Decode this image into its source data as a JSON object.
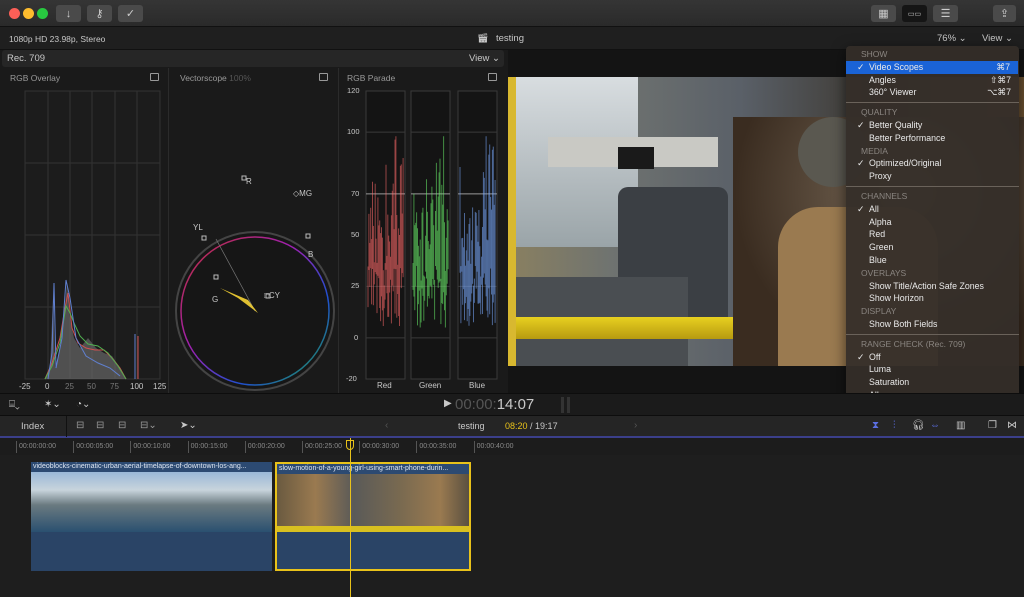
{
  "titlebar": {
    "buttons": [
      "import-icon",
      "key-icon",
      "checkmark-icon"
    ],
    "right_buttons": [
      "browser-layout-icon",
      "timeline-layout-icon",
      "inspector-icon",
      "share-icon"
    ]
  },
  "infobar": {
    "format": "1080p HD 23.98p, Stereo",
    "project": "testing",
    "zoom": "76%",
    "view": "View"
  },
  "scopes": {
    "standard": "Rec. 709",
    "view": "View",
    "rgb_overlay": {
      "title": "RGB Overlay",
      "x_ticks": [
        "-25",
        "0",
        "25",
        "50",
        "75",
        "100",
        "125"
      ]
    },
    "vectorscope": {
      "title": "Vectorscope",
      "scale": "100%",
      "targets": [
        "R",
        "MG",
        "YL",
        "B",
        "G",
        "CY"
      ]
    },
    "rgb_parade": {
      "title": "RGB Parade",
      "y_ticks": [
        "120",
        "100",
        "70",
        "50",
        "25",
        "0",
        "-20"
      ],
      "channels": [
        "Red",
        "Green",
        "Blue"
      ]
    }
  },
  "controls": {
    "timecode_dim": "00:00:",
    "timecode": "14:07"
  },
  "timeline": {
    "index": "Index",
    "project": "testing",
    "position": "08:20",
    "duration": "19:17",
    "ruler": [
      "00:00:00:00",
      "00:00:05:00",
      "00:00:10:00",
      "00:00:15:00",
      "00:00:20:00",
      "00:00:25:00",
      "00:00:30:00",
      "00:00:35:00",
      "00:00:40:00"
    ],
    "clips": [
      {
        "name": "videoblocks-cinematic-urban-aerial-timelapse-of-downtown-los-ang..."
      },
      {
        "name": "slow-motion-of-a-young-girl-using-smart-phone-durin..."
      }
    ]
  },
  "menu": {
    "show_header": "SHOW",
    "show": [
      {
        "label": "Video Scopes",
        "checked": true,
        "shortcut": "⌘7",
        "highlighted": true
      },
      {
        "label": "Angles",
        "shortcut": "⇧⌘7"
      },
      {
        "label": "360° Viewer",
        "shortcut": "⌥⌘7"
      }
    ],
    "quality_header": "QUALITY",
    "quality": [
      {
        "label": "Better Quality",
        "checked": true
      },
      {
        "label": "Better Performance"
      }
    ],
    "media_header": "MEDIA",
    "media": [
      {
        "label": "Optimized/Original",
        "checked": true
      },
      {
        "label": "Proxy"
      }
    ],
    "channels_header": "CHANNELS",
    "channels": [
      {
        "label": "All",
        "checked": true
      },
      {
        "label": "Alpha"
      },
      {
        "label": "Red"
      },
      {
        "label": "Green"
      },
      {
        "label": "Blue"
      }
    ],
    "overlays_header": "OVERLAYS",
    "overlays": [
      {
        "label": "Show Title/Action Safe Zones"
      },
      {
        "label": "Show Horizon"
      }
    ],
    "display_header": "DISPLAY",
    "display": [
      {
        "label": "Show Both Fields"
      }
    ],
    "range_header": "RANGE CHECK (Rec. 709)",
    "range": [
      {
        "label": "Off",
        "checked": true
      },
      {
        "label": "Luma"
      },
      {
        "label": "Saturation"
      },
      {
        "label": "All"
      }
    ],
    "check": "✓"
  },
  "colors": {
    "accent": "#1a63d6",
    "playhead": "#e8c21a",
    "clip": "#2c4a72"
  }
}
